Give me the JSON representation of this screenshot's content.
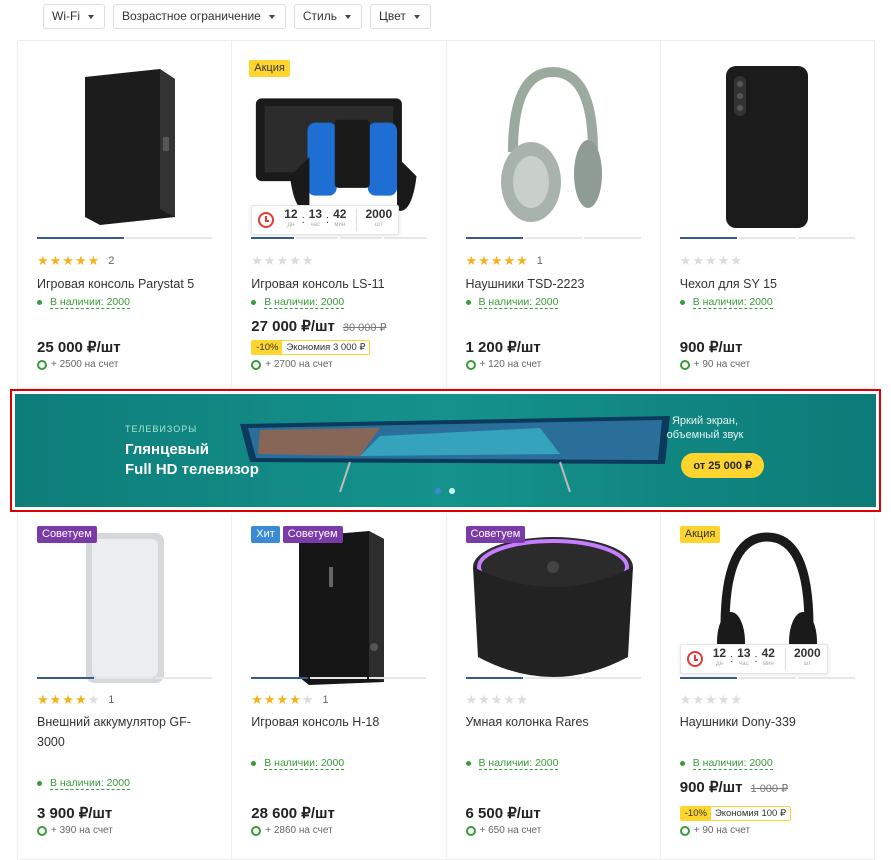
{
  "filters": [
    {
      "label": "Wi-Fi"
    },
    {
      "label": "Возрастное ограничение"
    },
    {
      "label": "Стиль"
    },
    {
      "label": "Цвет"
    }
  ],
  "timer_units": {
    "d": "дн",
    "h": "час",
    "m": "мин",
    "q": "шт"
  },
  "row1": [
    {
      "title": "Игровая консоль Parystat 5",
      "rating": 5,
      "reviews": "2",
      "stock": "В наличии: 2000",
      "price": "25 000 ₽/шт",
      "bonus": "+ 2500 на счет",
      "image": "console-icon"
    },
    {
      "title": "Игровая консоль LS-11",
      "rating": 0,
      "reviews": "",
      "stock": "В наличии: 2000",
      "price": "27 000 ₽/шт",
      "old_price": "30 000 ₽",
      "discount": "-10%",
      "economy": "Экономия 3 000 ₽",
      "bonus": "+ 2700 на счет",
      "badges": [
        "Акция"
      ],
      "timer": {
        "d": "12",
        "h": "13",
        "m": "42",
        "q": "2000"
      },
      "image": "switch-console-icon"
    },
    {
      "title": "Наушники TSD-2223",
      "rating": 5,
      "reviews": "1",
      "stock": "В наличии: 2000",
      "price": "1 200 ₽/шт",
      "bonus": "+ 120 на счет",
      "image": "headphones-icon"
    },
    {
      "title": "Чехол для SY 15",
      "rating": 0,
      "reviews": "",
      "stock": "В наличии: 2000",
      "price": "900 ₽/шт",
      "bonus": "+ 90 на счет",
      "image": "phone-case-icon"
    }
  ],
  "banner": {
    "category": "ТЕЛЕВИЗОРЫ",
    "title_line1": "Глянцевый",
    "title_line2": "Full HD телевизор",
    "subtitle_line1": "Яркий экран,",
    "subtitle_line2": "объемный звук",
    "button": "от 25 000 ₽",
    "colors": {
      "bg": "#15928c",
      "accent": "#fed52f"
    }
  },
  "row2": [
    {
      "title": "Внешний аккумулятор GF-3000",
      "rating": 4,
      "reviews": "1",
      "stock": "В наличии: 2000",
      "price": "3 900 ₽/шт",
      "bonus": "+ 390 на счет",
      "badges": [
        "Советуем"
      ],
      "image": "power-bank-icon"
    },
    {
      "title": "Игровая консоль H-18",
      "rating": 4,
      "reviews": "1",
      "stock": "В наличии: 2000",
      "price": "28 600 ₽/шт",
      "bonus": "+ 2860 на счет",
      "badges": [
        "Хит",
        "Советуем"
      ],
      "image": "console-icon"
    },
    {
      "title": "Умная колонка Rares",
      "rating": 0,
      "reviews": "",
      "stock": "В наличии: 2000",
      "price": "6 500 ₽/шт",
      "bonus": "+ 650 на счет",
      "badges": [
        "Советуем"
      ],
      "image": "smart-speaker-icon"
    },
    {
      "title": "Наушники Dony-339",
      "rating": 0,
      "reviews": "",
      "stock": "В наличии: 2000",
      "price": "900 ₽/шт",
      "old_price": "1 000 ₽",
      "discount": "-10%",
      "economy": "Экономия 100 ₽",
      "bonus": "+ 90 на счет",
      "badges": [
        "Акция"
      ],
      "timer": {
        "d": "12",
        "h": "13",
        "m": "42",
        "q": "2000"
      },
      "image": "headphones-icon"
    }
  ]
}
